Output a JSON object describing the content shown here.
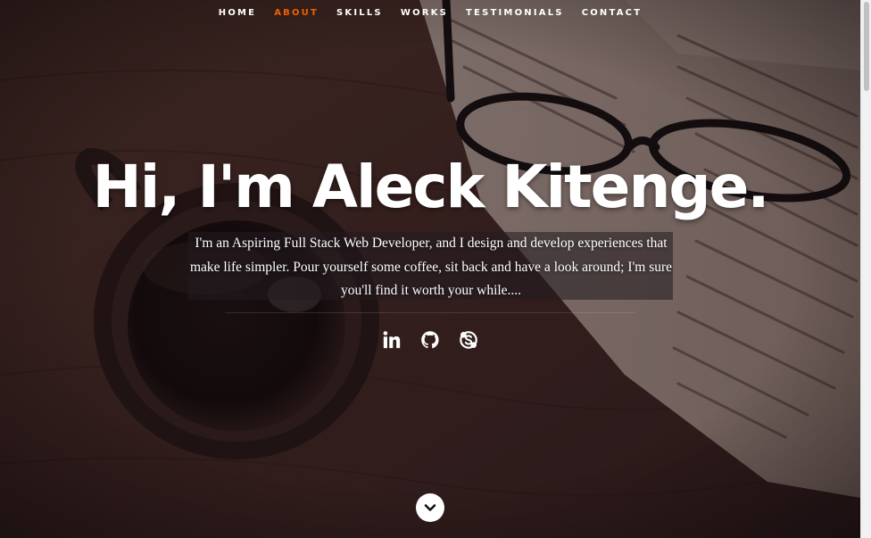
{
  "nav": {
    "items": [
      {
        "label": "HOME",
        "active": false
      },
      {
        "label": "ABOUT",
        "active": true
      },
      {
        "label": "SKILLS",
        "active": false
      },
      {
        "label": "WORKS",
        "active": false
      },
      {
        "label": "TESTIMONIALS",
        "active": false
      },
      {
        "label": "CONTACT",
        "active": false
      }
    ],
    "active_color": "#f06000"
  },
  "hero": {
    "headline": "Hi, I'm Aleck Kitenge.",
    "intro": "I'm an Aspiring Full Stack Web Developer, and I design and develop experiences that make life simpler. Pour yourself some coffee, sit back and have a look around; I'm sure you'll find it worth your while...."
  },
  "social": [
    {
      "icon": "linkedin-icon"
    },
    {
      "icon": "github-icon"
    },
    {
      "icon": "skype-icon"
    }
  ],
  "scroll_down": {
    "icon": "chevron-down-icon"
  }
}
